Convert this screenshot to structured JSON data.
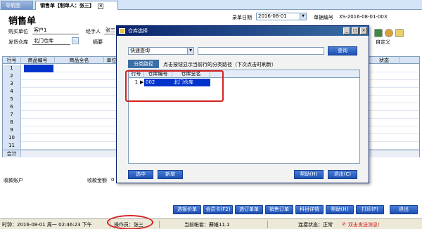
{
  "tabs": {
    "nav_label": "导航图",
    "sales_label": "销售单【制单人：张三】",
    "close_glyph": "×"
  },
  "form": {
    "title": "销售单",
    "entry_date_label": "录单日期",
    "entry_date_value": "2016-08-01",
    "doc_no_label": "单据编号",
    "doc_no_value": "XS-2016-08-01-003",
    "buyer_label": "购买单位",
    "buyer_value": "客户1",
    "handler_label": "经手人",
    "handler_value": "张三",
    "warehouse_label": "发货仓库",
    "warehouse_value": "北门仓库",
    "summary_label": "摘要",
    "custom_label": "自定义",
    "grid_headers": [
      "行号",
      "商品编号",
      "商品全名",
      "单位"
    ],
    "status_header": "状态",
    "row_numbers": [
      "1",
      "2",
      "3",
      "4",
      "5",
      "6",
      "7",
      "8",
      "9",
      "10",
      "11"
    ],
    "total_label": "合计",
    "receipt_account_label": "收款账户",
    "receipt_amount_label": "收款金额",
    "receipt_amount_value": "0"
  },
  "buttons": {
    "quote": "选报价单",
    "member_card": "会员卡(F2)",
    "order": "选订单单",
    "sales_order": "销售订单",
    "subject_detail": "科目详情",
    "help": "帮助(H)",
    "print": "打印(P)",
    "exit": "退出"
  },
  "statusbar": {
    "time": "时钟：2016-08-01 周一 02:46:23 下午",
    "operator": "操作员：张三",
    "account": "当前帐套：蘇維11.1",
    "connection": "连接状态：正常",
    "sms": "双击发送消息！"
  },
  "dialog": {
    "title": "仓库选择",
    "query_mode": "快速查询",
    "search_button": "查询",
    "path_button": "分类路径",
    "path_hint": "点击按钮显示当前行的分类路径（下次点击时刷新）",
    "headers": [
      "行号",
      "仓库编号",
      "仓库全名"
    ],
    "rows": [
      {
        "num": "1",
        "code": "002",
        "name": "北门仓库"
      }
    ],
    "select_button": "选中",
    "new_button": "新增",
    "help_button": "帮助(H)",
    "exit_button": "退出(C)"
  },
  "colors": {
    "accent": "#1d4fb3",
    "selection": "#0033cc",
    "highlight": "#d62020"
  }
}
